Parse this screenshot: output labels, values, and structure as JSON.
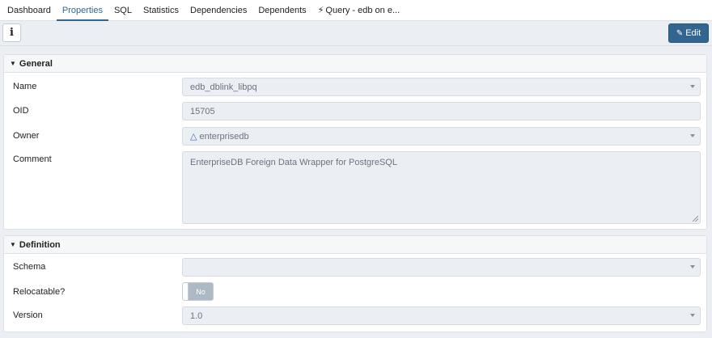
{
  "tabs": [
    {
      "label": "Dashboard"
    },
    {
      "label": "Properties"
    },
    {
      "label": "SQL"
    },
    {
      "label": "Statistics"
    },
    {
      "label": "Dependencies"
    },
    {
      "label": "Dependents"
    },
    {
      "label": "Query - edb on e..."
    }
  ],
  "active_tab": "Properties",
  "toolbar": {
    "info_label": "i",
    "edit_label": "Edit"
  },
  "general": {
    "title": "General",
    "name_label": "Name",
    "name_value": "edb_dblink_libpq",
    "oid_label": "OID",
    "oid_value": "15705",
    "owner_label": "Owner",
    "owner_value": "enterprisedb",
    "comment_label": "Comment",
    "comment_value": "EnterpriseDB Foreign Data Wrapper for PostgreSQL"
  },
  "definition": {
    "title": "Definition",
    "schema_label": "Schema",
    "schema_value": "",
    "relocatable_label": "Relocatable?",
    "relocatable_value": "No",
    "version_label": "Version",
    "version_value": "1.0"
  },
  "colors": {
    "accent": "#326690",
    "panel_bg": "#ebeef3",
    "field_bg": "#ebeef3"
  },
  "icons": {
    "query_tab": "lightning-icon",
    "info": "info-icon",
    "edit": "pencil-icon",
    "owner": "user-icon",
    "panel": "chevron-down-icon"
  }
}
